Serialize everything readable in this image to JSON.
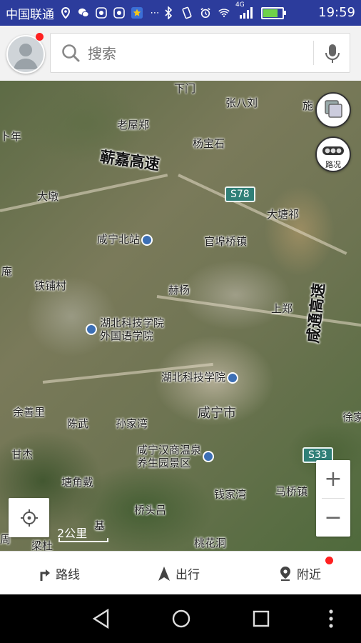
{
  "status_bar": {
    "carrier": "中国联通",
    "network": "4G",
    "time": "19:59"
  },
  "search": {
    "placeholder": "搜索"
  },
  "map": {
    "labels": {
      "xiamen": "下门",
      "zhangbaliu": "张八刘",
      "shi": "施",
      "laowuzheng": "老屋郑",
      "yangbaoshi": "杨宝石",
      "nian": "卜年",
      "qinjia_highway": "蕲嘉高速",
      "dadun": "大墩",
      "s78": "S78",
      "datangji": "大塘祁",
      "xianning_north": "咸宁北站",
      "guanbuqiao": "官埠桥镇",
      "an": "庵",
      "tiepucun": "铁铺村",
      "heyang": "赫杨",
      "hubei_sci_foreign_1": "湖北科技学院",
      "hubei_sci_foreign_2": "外国语学院",
      "shangzheng": "上郑",
      "xiantong_highway": "咸通高速",
      "hubei_sci": "湖北科技学院",
      "yushanli": "余善里",
      "chenwu": "陈武",
      "sunjiawan": "孙家湾",
      "xianning": "咸宁市",
      "xu": "徐家",
      "ganjie": "甘杰",
      "park_1": "咸宁汉商温泉",
      "park_2": "养生园景区",
      "s33": "S33",
      "tangjiaodai": "塘角戴",
      "qianjiawan": "钱家湾",
      "maqiao": "马桥镇",
      "qiaotoulu": "桥头吕",
      "liangcun": "梁杜",
      "ji": "基",
      "taohuadong": "桃花洞",
      "zhou": "周",
      "traffic": "路况"
    },
    "scale_label": "2公里",
    "zoom_in": "+",
    "zoom_out": "−"
  },
  "bottom_nav": {
    "route": "路线",
    "travel": "出行",
    "nearby": "附近"
  }
}
